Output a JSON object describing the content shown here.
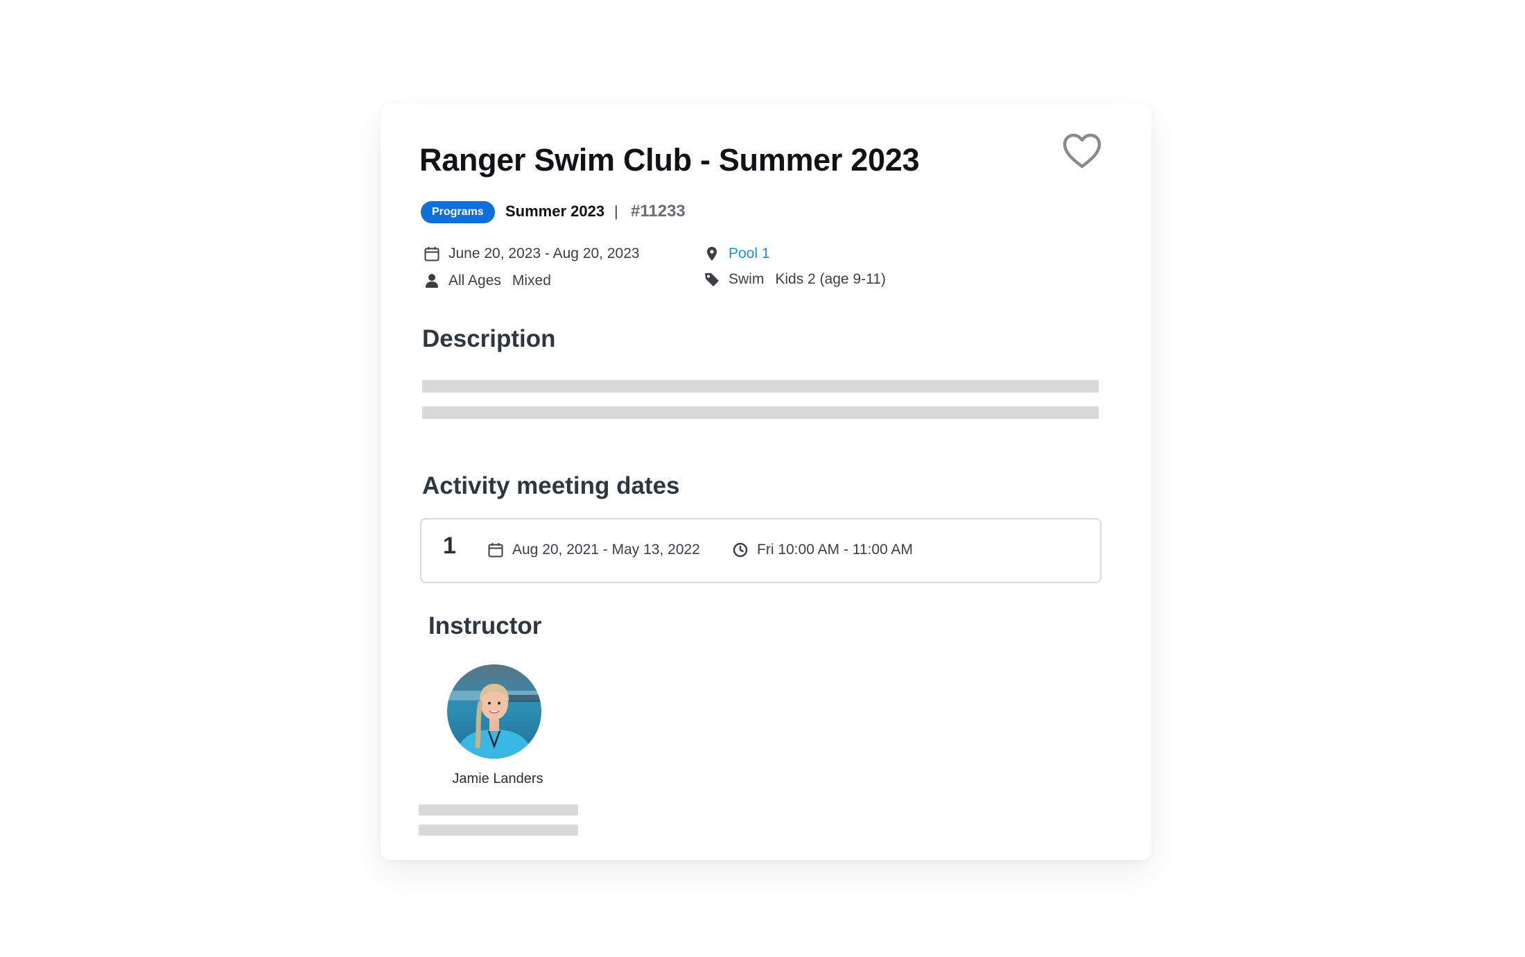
{
  "activity": {
    "title": "Ranger Swim Club - Summer 2023",
    "category_badge": "Programs",
    "season": "Summer 2023",
    "separator": "|",
    "code": "#11233",
    "dates": "June 20, 2023 - Aug 20, 2023",
    "ages": "All Ages",
    "gender": "Mixed",
    "location": "Pool 1",
    "tags": [
      "Swim",
      "Kids 2 (age 9-11)"
    ]
  },
  "sections": {
    "description_heading": "Description",
    "meeting_heading": "Activity meeting dates",
    "instructor_heading": "Instructor"
  },
  "meeting": {
    "number": "1",
    "date_range": "Aug 20, 2021 - May 13, 2022",
    "time": "Fri 10:00 AM - 11:00 AM"
  },
  "instructor": {
    "name": "Jamie Landers"
  },
  "icons": {
    "favorite": "heart-outline-icon",
    "dates": "calendar-icon",
    "ages": "person-icon",
    "location": "map-pin-icon",
    "tags": "tag-icon",
    "time": "clock-icon"
  },
  "colors": {
    "badge": "#0f6fdb",
    "link": "#1a93d6",
    "placeholder": "#d9d9d9"
  }
}
